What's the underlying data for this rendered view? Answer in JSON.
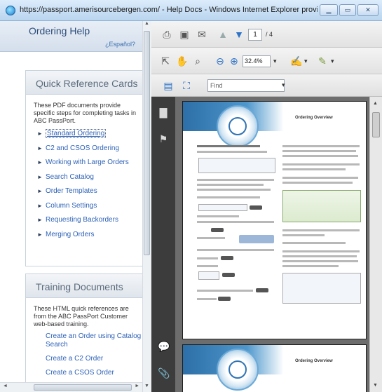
{
  "window": {
    "title": "https://passport.amerisourcebergen.com/ - Help Docs - Windows Internet Explorer provi..."
  },
  "help": {
    "title": "Ordering Help",
    "link": "¿Español?"
  },
  "quick_reference": {
    "header": "Quick Reference Cards",
    "description": "These PDF documents provide specific steps for completing tasks in ABC PassPort.",
    "links": [
      "Standard Ordering",
      "C2 and CSOS Ordering",
      "Working with Large Orders",
      "Search Catalog",
      "Order Templates",
      "Column Settings",
      "Requesting Backorders",
      "Merging Orders"
    ]
  },
  "training": {
    "header": "Training Documents",
    "description": "These HTML quick references are from the ABC PassPort Customer web-based training.",
    "links": [
      "Create an Order using Catalog Search",
      "Create a C2 Order",
      "Create a CSOS Order"
    ]
  },
  "reader": {
    "current_page": "1",
    "page_total": "/ 4",
    "zoom": "32.4%",
    "find_placeholder": "Find",
    "page_heading": "Ordering Overview",
    "icons": [
      "print-icon",
      "save-icon",
      "email-icon",
      "previous-page-icon",
      "next-page-icon",
      "select-icon",
      "hand-icon",
      "zoom-tool-icon",
      "zoom-out-icon",
      "zoom-in-icon",
      "sign-icon",
      "pen-icon",
      "page-thumbnails-icon",
      "bookmarks-icon",
      "comments-icon",
      "attachments-icon"
    ]
  }
}
